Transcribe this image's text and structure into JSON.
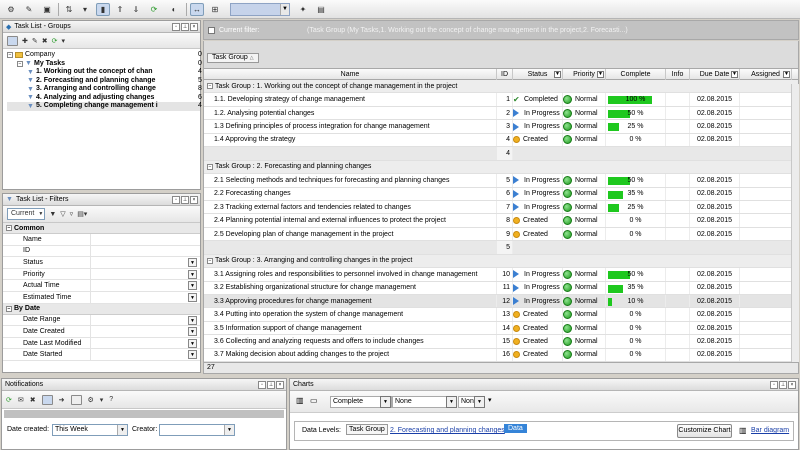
{
  "current_filter": {
    "label": "Current filter:",
    "value": "(Task Group  (My Tasks,1. Working out the concept of change management in the project,2. Forecasti...)"
  },
  "groups_panel": {
    "title": "Task List - Groups",
    "tree": [
      {
        "label": "Company",
        "count": "0",
        "bold": false,
        "level": 0
      },
      {
        "label": "My Tasks",
        "count": "0",
        "bold": true,
        "level": 1
      },
      {
        "label": "1. Working out the concept of chan",
        "count": "4",
        "bold": true,
        "level": 2
      },
      {
        "label": "2. Forecasting and planning change",
        "count": "5",
        "bold": true,
        "level": 2
      },
      {
        "label": "3. Arranging and controlling change",
        "count": "8",
        "bold": true,
        "level": 2
      },
      {
        "label": "4. Analyzing and adjusting changes",
        "count": "6",
        "bold": true,
        "level": 2
      },
      {
        "label": "5. Completing change management i",
        "count": "4",
        "bold": true,
        "level": 2
      }
    ]
  },
  "filters_panel": {
    "title": "Task List - Filters",
    "current_label": "Current",
    "sections": [
      {
        "name": "Common",
        "rows": [
          {
            "label": "Name",
            "dropdown": false
          },
          {
            "label": "ID",
            "dropdown": false
          },
          {
            "label": "Status",
            "dropdown": true
          },
          {
            "label": "Priority",
            "dropdown": true
          },
          {
            "label": "Actual Time",
            "dropdown": true
          },
          {
            "label": "Estimated Time",
            "dropdown": true
          }
        ]
      },
      {
        "name": "By Date",
        "rows": [
          {
            "label": "Date Range",
            "dropdown": true
          },
          {
            "label": "Date Created",
            "dropdown": true
          },
          {
            "label": "Date Last Modified",
            "dropdown": true
          },
          {
            "label": "Date Started",
            "dropdown": true
          }
        ]
      }
    ]
  },
  "grid": {
    "group_tag": "Task Group",
    "columns": [
      "Name",
      "ID",
      "Status",
      "Priority",
      "Complete",
      "Info",
      "Due Date",
      "Assigned"
    ],
    "groups": [
      {
        "title": "Task Group : 1. Working out the concept of change management in the project",
        "footer": "4",
        "tasks": [
          {
            "name": "1.1. Developing strategy of change management",
            "id": "1",
            "status": "Completed",
            "priority": "Normal",
            "complete": "100 %",
            "pct": 100,
            "due": "02.08.2015"
          },
          {
            "name": "1.2. Analysing potential changes",
            "id": "2",
            "status": "In Progress",
            "priority": "Normal",
            "complete": "50 %",
            "pct": 50,
            "due": "02.08.2015"
          },
          {
            "name": "1.3 Defining principles of process integration for change management",
            "id": "3",
            "status": "In Progress",
            "priority": "Normal",
            "complete": "25 %",
            "pct": 25,
            "due": "02.08.2015"
          },
          {
            "name": "1.4 Approving the strategy",
            "id": "4",
            "status": "Created",
            "priority": "Normal",
            "complete": "0 %",
            "pct": 0,
            "due": "02.08.2015"
          }
        ]
      },
      {
        "title": "Task Group : 2. Forecasting and planning changes",
        "footer": "5",
        "tasks": [
          {
            "name": "2.1 Selecting methods and techniques for forecasting and planning changes",
            "id": "5",
            "status": "In Progress",
            "priority": "Normal",
            "complete": "50 %",
            "pct": 50,
            "due": "02.08.2015"
          },
          {
            "name": "2.2 Forecasting changes",
            "id": "6",
            "status": "In Progress",
            "priority": "Normal",
            "complete": "35 %",
            "pct": 35,
            "due": "02.08.2015"
          },
          {
            "name": "2.3 Tracking external factors and tendencies related to changes",
            "id": "7",
            "status": "In Progress",
            "priority": "Normal",
            "complete": "25 %",
            "pct": 25,
            "due": "02.08.2015"
          },
          {
            "name": "2.4 Planning potential internal and external influences to protect the project",
            "id": "8",
            "status": "Created",
            "priority": "Normal",
            "complete": "0 %",
            "pct": 0,
            "due": "02.08.2015"
          },
          {
            "name": "2.5 Developing plan of change management in the project",
            "id": "9",
            "status": "Created",
            "priority": "Normal",
            "complete": "0 %",
            "pct": 0,
            "due": "02.08.2015"
          }
        ]
      },
      {
        "title": "Task Group : 3. Arranging and controlling changes in the project",
        "footer": "",
        "tasks": [
          {
            "name": "3.1 Assigning roles and responsibilities to personnel involved in change management",
            "id": "10",
            "status": "In Progress",
            "priority": "Normal",
            "complete": "50 %",
            "pct": 50,
            "due": "02.08.2015"
          },
          {
            "name": "3.2 Establishing organizational structure for change management",
            "id": "11",
            "status": "In Progress",
            "priority": "Normal",
            "complete": "35 %",
            "pct": 35,
            "due": "02.08.2015"
          },
          {
            "name": "3.3 Approving procedures for change management",
            "id": "12",
            "status": "In Progress",
            "priority": "Normal",
            "complete": "10 %",
            "pct": 10,
            "due": "02.08.2015",
            "selected": true
          },
          {
            "name": "3.4 Putting into operation the system of change management",
            "id": "13",
            "status": "Created",
            "priority": "Normal",
            "complete": "0 %",
            "pct": 0,
            "due": "02.08.2015"
          },
          {
            "name": "3.5 Information support of change management",
            "id": "14",
            "status": "Created",
            "priority": "Normal",
            "complete": "0 %",
            "pct": 0,
            "due": "02.08.2015"
          },
          {
            "name": "3.6 Collecting and analyzing requests and offers to include changes",
            "id": "15",
            "status": "Created",
            "priority": "Normal",
            "complete": "0 %",
            "pct": 0,
            "due": "02.08.2015"
          },
          {
            "name": "3.7 Making decision about adding changes to the project",
            "id": "16",
            "status": "Created",
            "priority": "Normal",
            "complete": "0 %",
            "pct": 0,
            "due": "02.08.2015"
          }
        ]
      }
    ],
    "status_count": "27"
  },
  "notifications": {
    "title": "Notifications",
    "date_created_label": "Date created:",
    "date_created_value": "This Week",
    "creator_label": "Creator:",
    "creator_value": ""
  },
  "charts": {
    "title": "Charts",
    "combo1": "Complete",
    "combo2": "None",
    "combo3": "Non",
    "data_levels_label": "Data Levels:",
    "level1": "Task Group",
    "level2": "2. Forecasting and planning changes",
    "level3": "Data",
    "customize_label": "Customize Chart",
    "bar_diagram_label": "Bar diagram"
  }
}
